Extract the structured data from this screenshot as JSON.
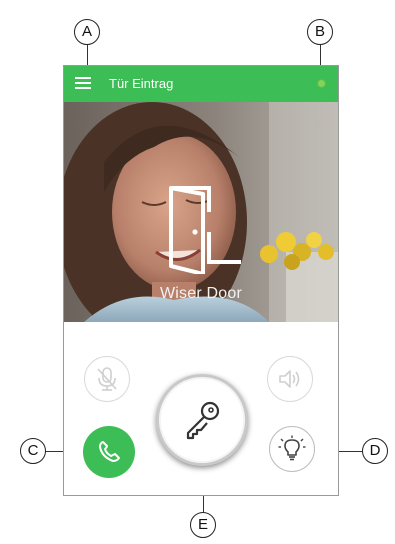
{
  "app": {
    "title": "Tür Eintrag",
    "accent_color": "#3dbd55",
    "status_color": "#7fd45a"
  },
  "video": {
    "caption": "Wiser Door",
    "overlay_icon": "open-door-icon"
  },
  "controls": {
    "mic": {
      "icon": "mic-muted-icon"
    },
    "speaker": {
      "icon": "speaker-icon"
    },
    "call": {
      "icon": "phone-icon"
    },
    "unlock": {
      "icon": "key-icon"
    },
    "light": {
      "icon": "light-bulb-icon"
    }
  },
  "callouts": {
    "a": "A",
    "b": "B",
    "c": "C",
    "d": "D",
    "e": "E"
  }
}
